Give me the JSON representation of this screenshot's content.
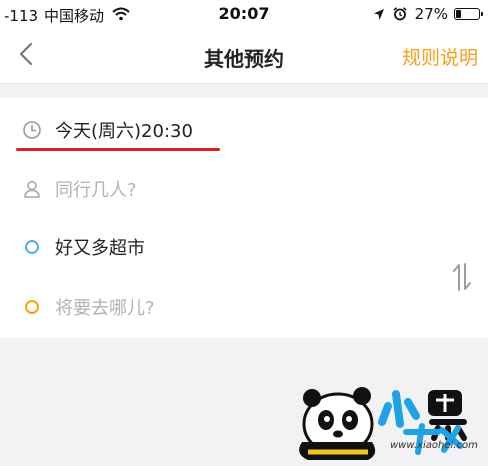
{
  "status_bar": {
    "signal": "-113",
    "carrier": "中国移动",
    "time": "20:07",
    "battery_percent": "27%",
    "battery_level": 0.27,
    "icons": [
      "wifi-icon",
      "location-arrow-icon",
      "alarm-icon",
      "battery-icon"
    ]
  },
  "nav": {
    "title": "其他预约",
    "rules_label": "规则说明",
    "back_icon": "chevron-left-icon"
  },
  "form": {
    "time_value": "今天(周六)20:30",
    "people_placeholder": "同行几人?",
    "origin_value": "好又多超市",
    "destination_placeholder": "将要去哪儿?",
    "swap_icon": "swap-vertical-icon"
  },
  "watermark": {
    "url": "www.xiaohei.com"
  },
  "colors": {
    "accent_orange": "#f5a019",
    "origin_dot": "#56aef0",
    "destination_dot": "#f7a11a",
    "highlight_underline": "#d7201f",
    "placeholder": "#b3b3b3",
    "background": "#f2f2f4"
  }
}
